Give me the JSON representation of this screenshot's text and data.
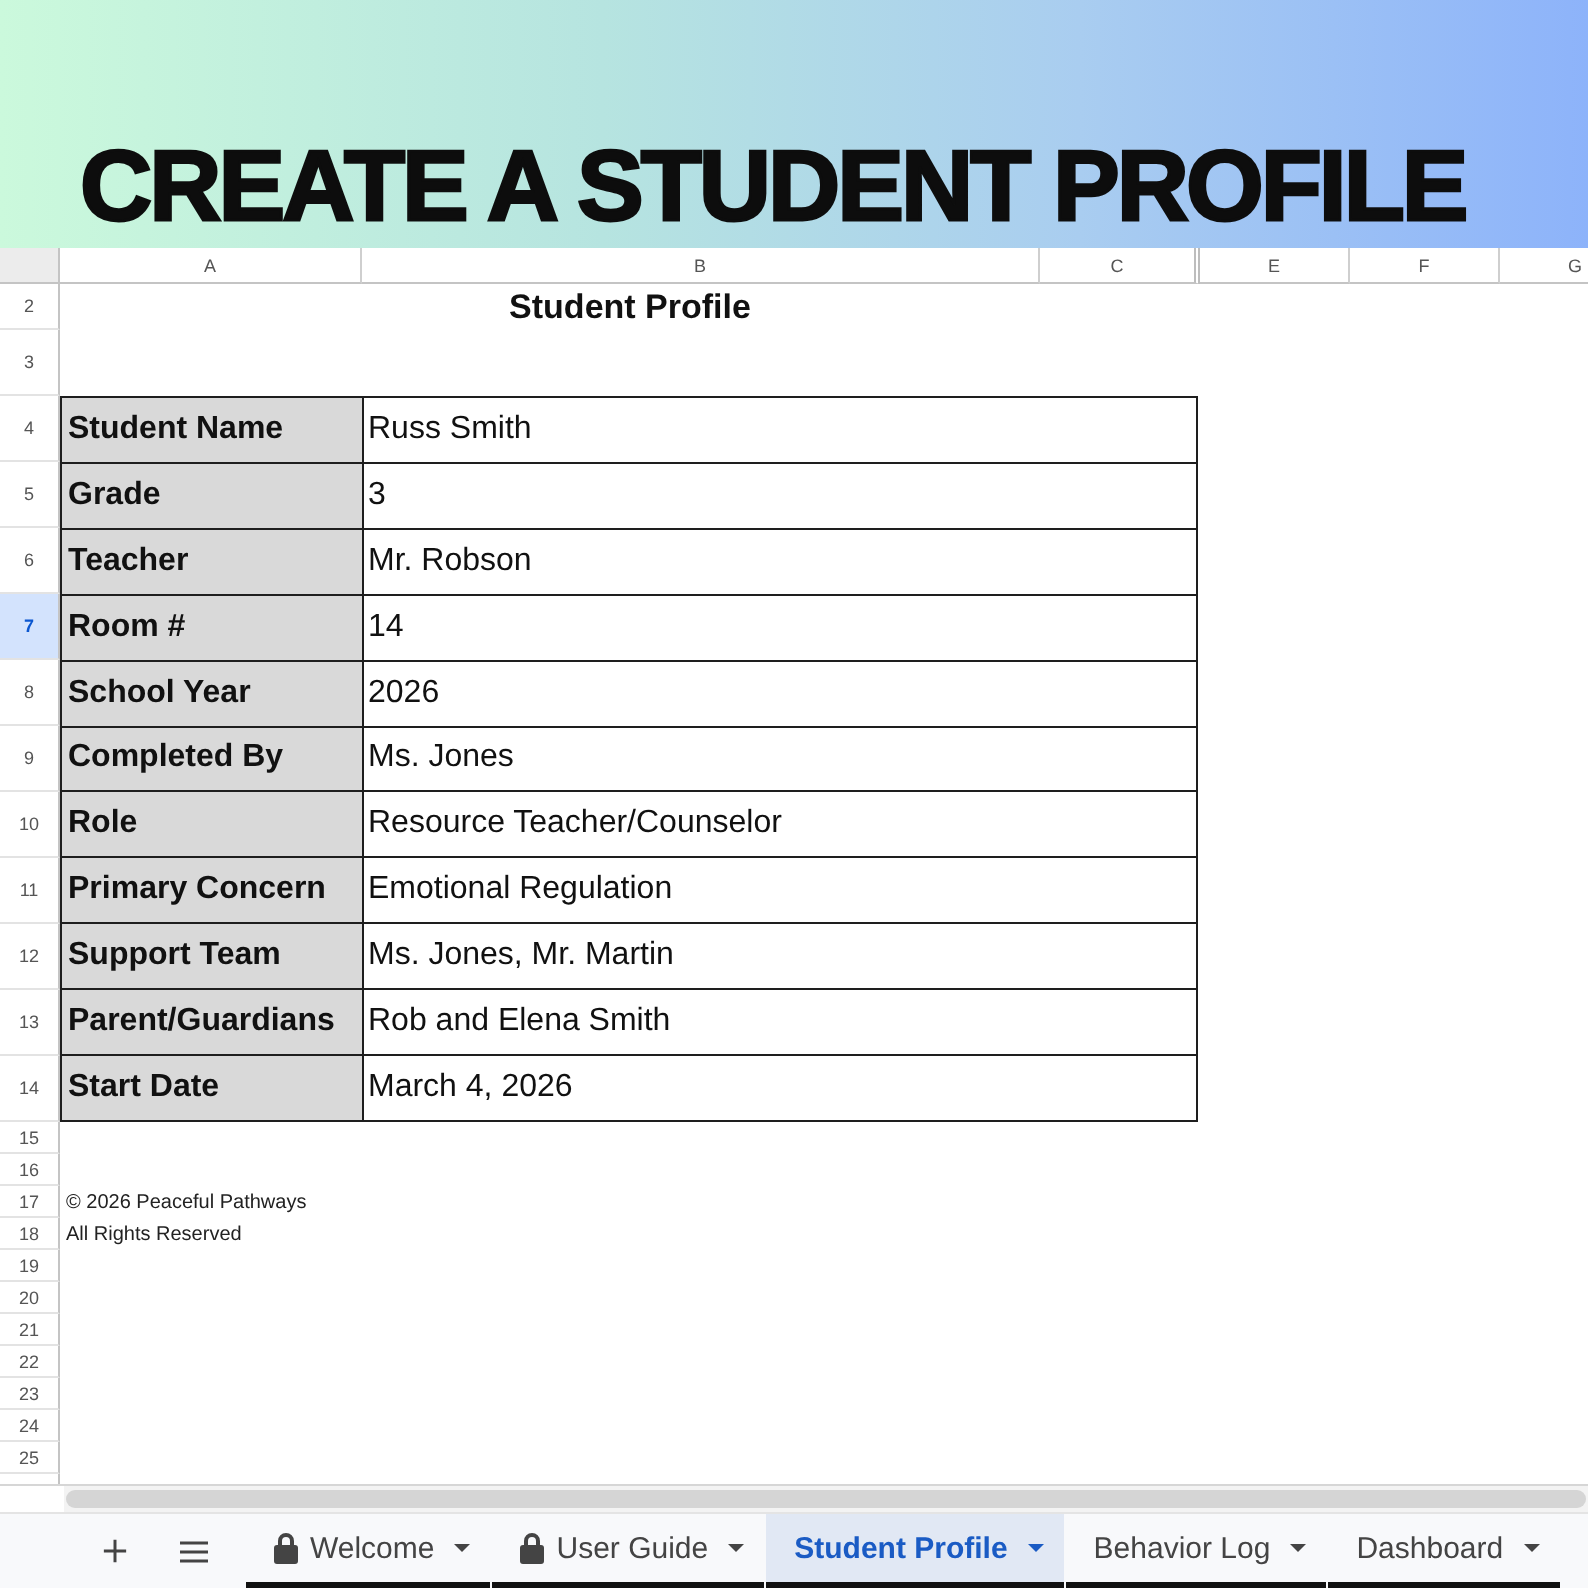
{
  "banner": {
    "title": "CREATE A STUDENT PROFILE"
  },
  "sheet": {
    "columns": [
      "A",
      "B",
      "C",
      "E",
      "F",
      "G"
    ],
    "rows": [
      {
        "label": "2",
        "selected": false
      },
      {
        "label": "3",
        "selected": false
      },
      {
        "label": "4",
        "selected": false
      },
      {
        "label": "5",
        "selected": false
      },
      {
        "label": "6",
        "selected": false
      },
      {
        "label": "7",
        "selected": true
      },
      {
        "label": "8",
        "selected": false
      },
      {
        "label": "9",
        "selected": false
      },
      {
        "label": "10",
        "selected": false
      },
      {
        "label": "11",
        "selected": false
      },
      {
        "label": "12",
        "selected": false
      },
      {
        "label": "13",
        "selected": false
      },
      {
        "label": "14",
        "selected": false
      },
      {
        "label": "15",
        "selected": false
      },
      {
        "label": "16",
        "selected": false
      },
      {
        "label": "17",
        "selected": false
      },
      {
        "label": "18",
        "selected": false
      },
      {
        "label": "19",
        "selected": false
      },
      {
        "label": "20",
        "selected": false
      },
      {
        "label": "21",
        "selected": false
      },
      {
        "label": "22",
        "selected": false
      },
      {
        "label": "23",
        "selected": false
      },
      {
        "label": "24",
        "selected": false
      },
      {
        "label": "25",
        "selected": false
      }
    ],
    "title": "Student Profile",
    "fields": [
      {
        "label": "Student Name",
        "value": "Russ Smith"
      },
      {
        "label": "Grade",
        "value": "3"
      },
      {
        "label": "Teacher",
        "value": "Mr. Robson"
      },
      {
        "label": "Room #",
        "value": "14"
      },
      {
        "label": "School Year",
        "value": "2026"
      },
      {
        "label": "Completed By",
        "value": "Ms. Jones"
      },
      {
        "label": "Role",
        "value": "Resource Teacher/Counselor"
      },
      {
        "label": "Primary Concern",
        "value": "Emotional Regulation"
      },
      {
        "label": "Support Team",
        "value": "Ms. Jones, Mr. Martin"
      },
      {
        "label": "Parent/Guardians",
        "value": "Rob and Elena Smith"
      },
      {
        "label": "Start Date",
        "value": "March 4, 2026"
      }
    ],
    "footer": [
      "© 2026 Peaceful Pathways",
      "All Rights Reserved"
    ]
  },
  "sheet_tabs": [
    {
      "label": "Welcome",
      "locked": true,
      "selected": false
    },
    {
      "label": "User Guide",
      "locked": true,
      "selected": false
    },
    {
      "label": "Student Profile",
      "locked": false,
      "selected": true
    },
    {
      "label": "Behavior Log",
      "locked": false,
      "selected": false
    },
    {
      "label": "Dashboard",
      "locked": false,
      "selected": false
    }
  ]
}
